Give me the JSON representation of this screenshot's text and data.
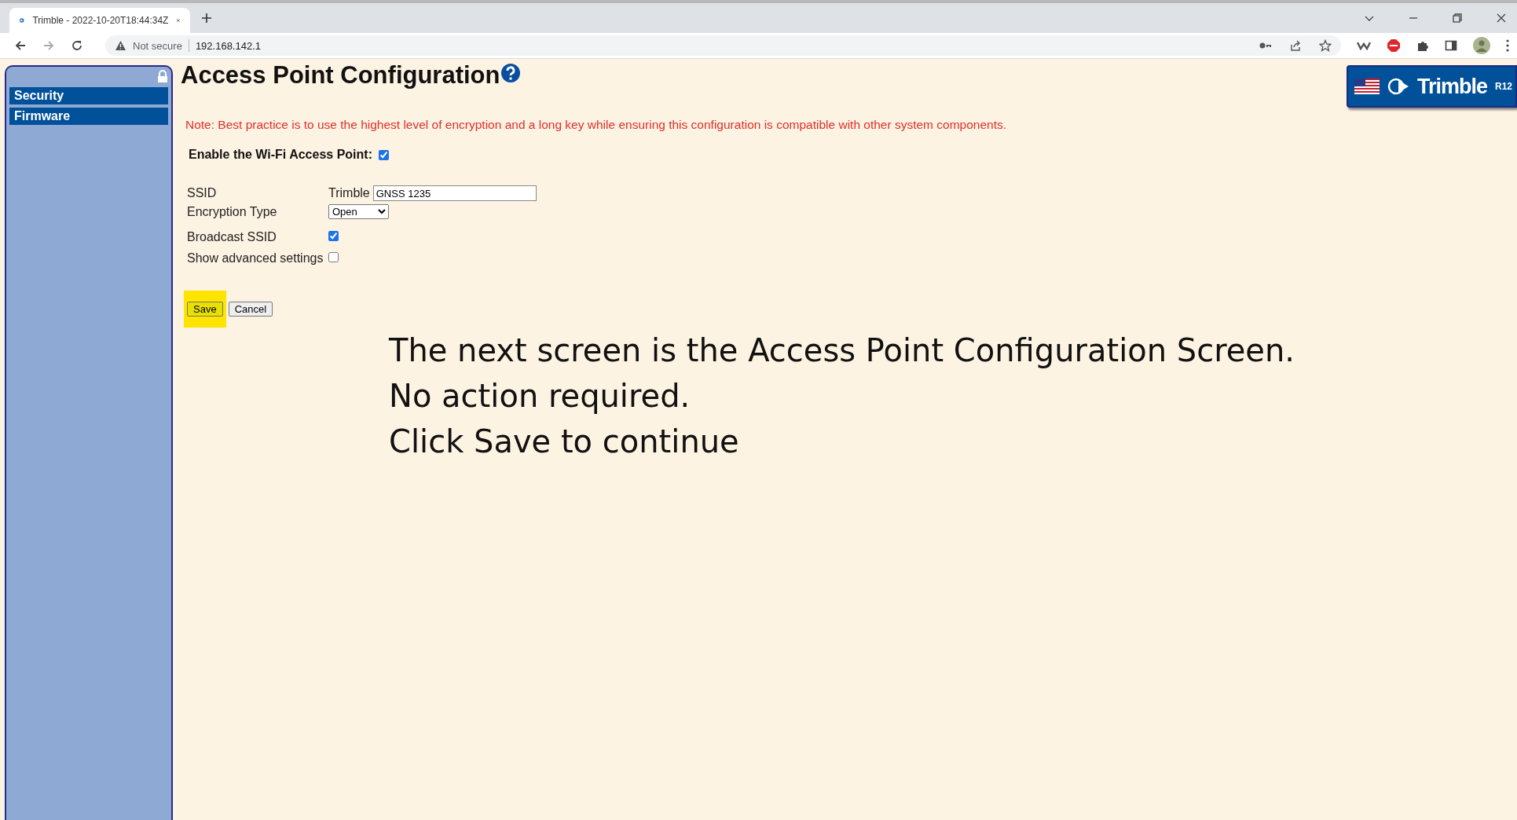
{
  "browser": {
    "tab": {
      "title": "Trimble - 2022-10-20T18:44:34Z"
    },
    "address": {
      "security": "Not secure",
      "url": "192.168.142.1"
    }
  },
  "sidebar": {
    "items": [
      {
        "label": "Security",
        "selected": false
      },
      {
        "label": "Firmware",
        "selected": false
      }
    ]
  },
  "header": {
    "title": "Access Point Configuration",
    "logo": {
      "brand": "Trimble",
      "model": "R12"
    }
  },
  "note": "Note: Best practice is to use the highest level of encryption and a long key while ensuring this configuration is compatible with other system components.",
  "enable": {
    "label": "Enable the Wi-Fi Access Point:",
    "checked": true
  },
  "ssid": {
    "label": "SSID",
    "prefix": "Trimble",
    "value": "GNSS 1235"
  },
  "encryption": {
    "label": "Encryption Type",
    "value": "Open"
  },
  "options": [
    {
      "label": "Broadcast SSID",
      "checked": true
    },
    {
      "label": "Show advanced settings",
      "checked": false
    }
  ],
  "buttons": [
    {
      "label": "Save",
      "highlighted": true
    },
    {
      "label": "Cancel",
      "highlighted": false
    }
  ],
  "caption": [
    "The next screen is the Access Point Configuration Screen.",
    "No action required.",
    "Click Save to continue"
  ]
}
